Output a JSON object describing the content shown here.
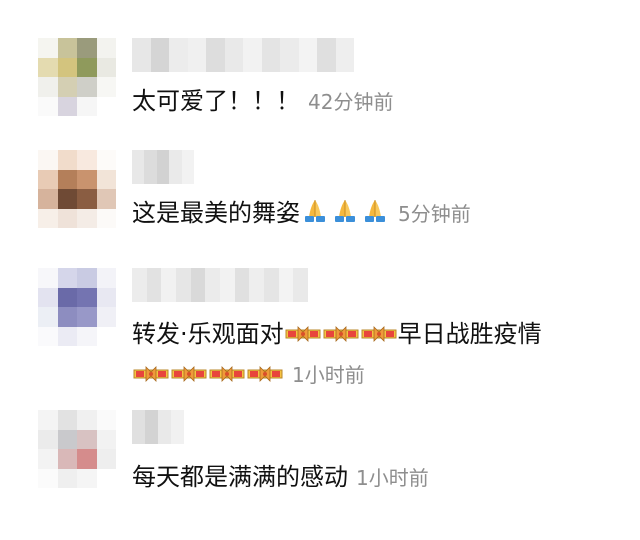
{
  "comments": [
    {
      "text": "太可爱了！！！",
      "time": "42分钟前",
      "avatar_colors": [
        "#f5f5f0",
        "#c8c39a",
        "#9a9b7c",
        "#f3f3ef",
        "#e4dbb0",
        "#d3c47e",
        "#8f9a5c",
        "#e9e9e2",
        "#f0f0ec",
        "#d4cfb3",
        "#cfcfc8",
        "#f7f7f4",
        "#fafafa",
        "#d8d4df",
        "#f6f6f6",
        "#ffffff"
      ],
      "name_colors": [
        "#e7e7e7",
        "#d5d5d5",
        "#ececec",
        "#f0f0f0",
        "#dddddd",
        "#e9e9e9",
        "#f2f2f2",
        "#e4e4e4",
        "#ebebeb",
        "#f3f3f3",
        "#dfdfdf",
        "#eeeeee"
      ]
    },
    {
      "text": "这是最美的舞姿",
      "emoji": [
        "pray-emoji",
        "pray-emoji",
        "pray-emoji"
      ],
      "time": "5分钟前",
      "avatar_colors": [
        "#fbf7f3",
        "#f1dccb",
        "#f8e9df",
        "#fdfbf9",
        "#e8cbb5",
        "#b47f5a",
        "#c9936e",
        "#f2e4d8",
        "#d6b39c",
        "#6f4a35",
        "#8a5d42",
        "#e0c7b6",
        "#f7efe8",
        "#efe2d9",
        "#f4ece6",
        "#fcfaf8"
      ],
      "name_colors": [
        "#e8e8e8",
        "#dcdcdc",
        "#d2d2d2",
        "#eaeaea",
        "#f2f2f2"
      ]
    },
    {
      "text1": "转发·乐观面对",
      "emoji1": [
        "ribbon-emoji",
        "ribbon-emoji",
        "ribbon-emoji"
      ],
      "text1b": "早日战胜疫情",
      "emoji2": [
        "ribbon-emoji",
        "ribbon-emoji",
        "ribbon-emoji",
        "ribbon-emoji"
      ],
      "time": "1小时前",
      "avatar_colors": [
        "#f7f7fa",
        "#d5d6ea",
        "#c9cbe3",
        "#f3f3f8",
        "#e3e3f0",
        "#6a6aa8",
        "#7474b1",
        "#e8e8f2",
        "#eceff5",
        "#8d8dc0",
        "#9898c8",
        "#f0f0f6",
        "#fafafc",
        "#ebebf4",
        "#f5f5f9",
        "#ffffff"
      ],
      "name_colors": [
        "#ececec",
        "#e2e2e2",
        "#f1f1f1",
        "#e6e6e6",
        "#d9d9d9",
        "#ebebeb",
        "#f2f2f2",
        "#e0e0e0",
        "#eeeeee",
        "#e5e5e5",
        "#f3f3f3",
        "#e9e9e9"
      ]
    },
    {
      "text": "每天都是满满的感动",
      "time": "1小时前",
      "avatar_colors": [
        "#f4f4f4",
        "#e2e2e2",
        "#f0f0f0",
        "#fafafa",
        "#ebebeb",
        "#c9c9cc",
        "#d8c2c2",
        "#f2f2f2",
        "#f3f3f3",
        "#d9b8b8",
        "#d58c8c",
        "#eeeeee",
        "#fbfbfb",
        "#efefef",
        "#f5f5f5",
        "#ffffff"
      ],
      "name_colors": [
        "#e0e0e0",
        "#d3d3d3",
        "#e9e9e9",
        "#f1f1f1"
      ]
    }
  ]
}
